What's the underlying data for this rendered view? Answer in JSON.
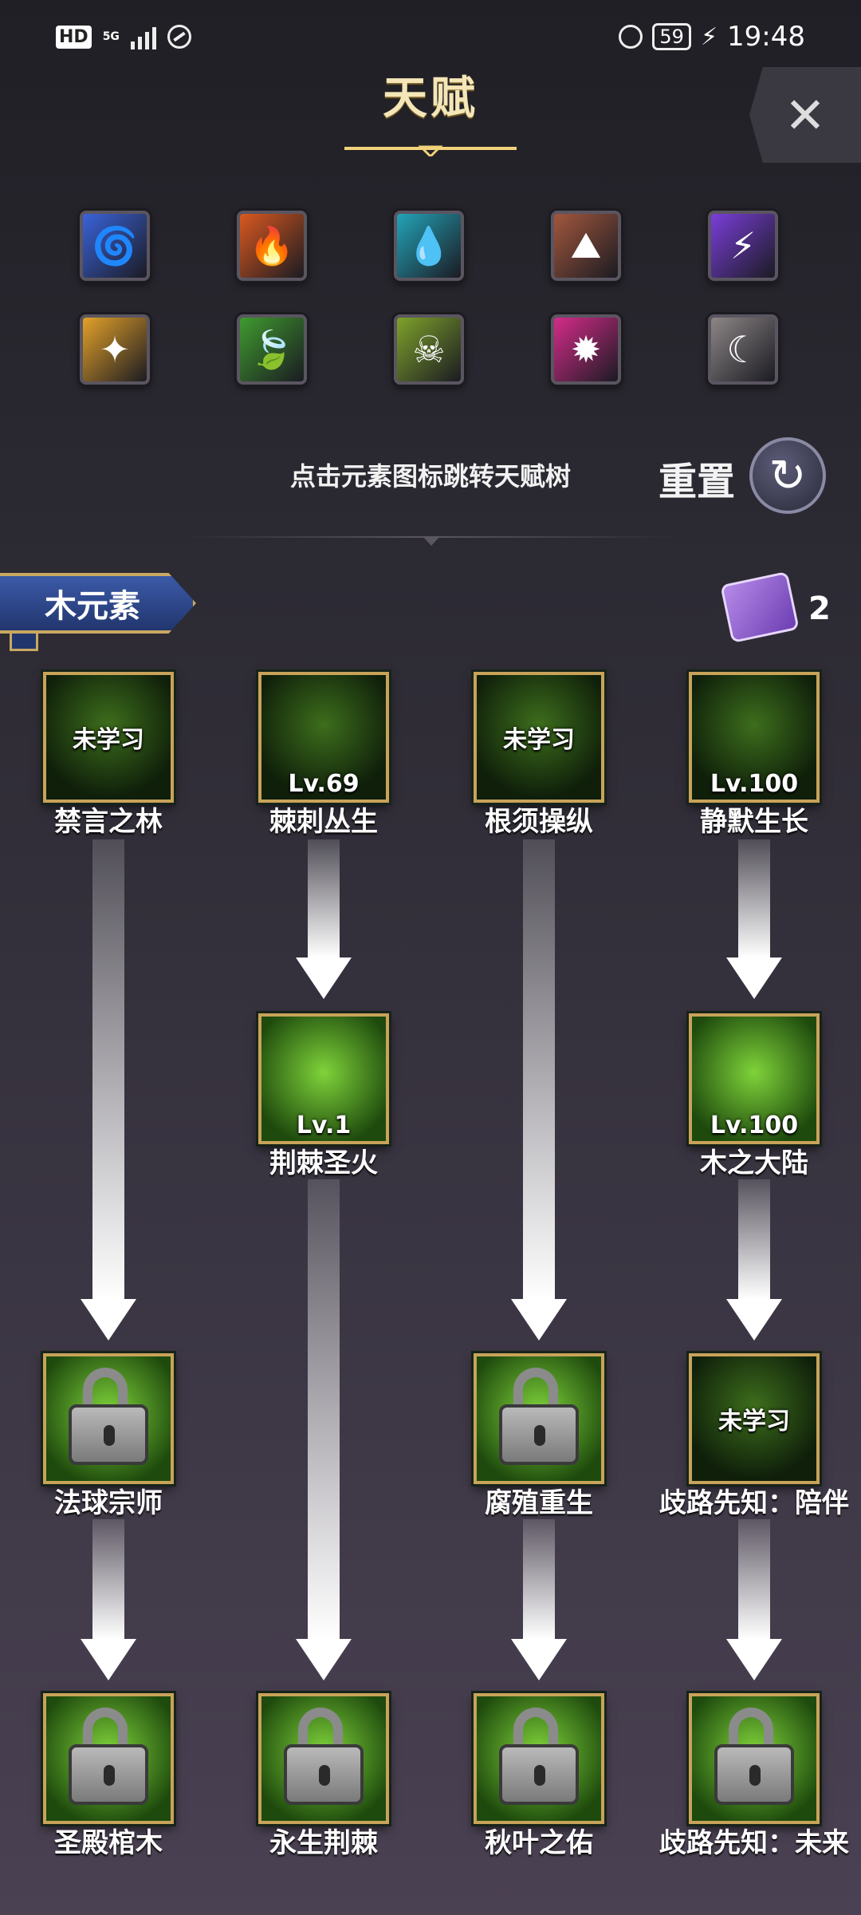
{
  "status_bar": {
    "hd": "HD",
    "network": "5G",
    "battery": "59",
    "time": "19:48"
  },
  "header": {
    "title": "天赋"
  },
  "elements": {
    "row1": [
      {
        "name": "wind-element-icon",
        "glyph": "🌀",
        "color": "#3a63d9"
      },
      {
        "name": "fire-element-icon",
        "glyph": "🔥",
        "color": "#d9581f"
      },
      {
        "name": "water-element-icon",
        "glyph": "💧",
        "color": "#23a3b8"
      },
      {
        "name": "earth-element-icon",
        "glyph": "⛰",
        "color": "#a2573d"
      },
      {
        "name": "thunder-element-icon",
        "glyph": "⚡",
        "color": "#7a3ed9"
      }
    ],
    "row2": [
      {
        "name": "light-element-icon",
        "glyph": "✦",
        "color": "#e3a129"
      },
      {
        "name": "wood-element-icon",
        "glyph": "🍃",
        "color": "#3f9a2f"
      },
      {
        "name": "poison-element-icon",
        "glyph": "☠",
        "color": "#7ea22b"
      },
      {
        "name": "arcane-element-icon",
        "glyph": "✹",
        "color": "#d52b8a"
      },
      {
        "name": "moon-element-icon",
        "glyph": "☾",
        "color": "#8c8686"
      }
    ]
  },
  "hint": "点击元素图标跳转天赋树",
  "reset_label": "重置",
  "current_element": "木元素",
  "scroll_count": "2",
  "talents": {
    "n1": {
      "name": "禁言之林",
      "status": "未学习"
    },
    "n2": {
      "name": "棘刺丛生",
      "level": "Lv.69"
    },
    "n3": {
      "name": "根须操纵",
      "status": "未学习"
    },
    "n4": {
      "name": "静默生长",
      "level": "Lv.100"
    },
    "n5": {
      "name": "荆棘圣火",
      "level": "Lv.1"
    },
    "n6": {
      "name": "木之大陆",
      "level": "Lv.100"
    },
    "n7": {
      "name": "法球宗师"
    },
    "n8": {
      "name": "腐殖重生"
    },
    "n9": {
      "name": "歧路先知：陪伴",
      "status": "未学习"
    },
    "n10": {
      "name": "圣殿棺木"
    },
    "n11": {
      "name": "永生荆棘"
    },
    "n12": {
      "name": "秋叶之佑"
    },
    "n13": {
      "name": "歧路先知：未来"
    }
  }
}
